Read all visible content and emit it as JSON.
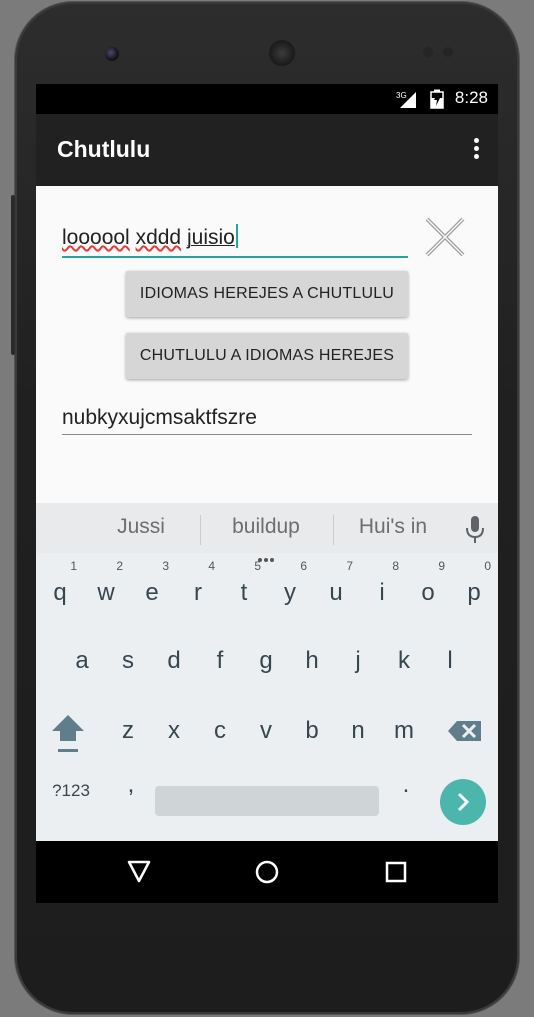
{
  "status_bar": {
    "network": "3G",
    "time": "8:28"
  },
  "app_bar": {
    "title": "Chutlulu",
    "overflow_icon": "more-vert-icon"
  },
  "main": {
    "input": {
      "words": [
        "loooool",
        "xddd",
        "juisio"
      ]
    },
    "clear_icon": "close-icon",
    "buttons": {
      "heretic_to_chutlulu": "IDIOMAS HEREJES A CHUTLULU",
      "chutlulu_to_heretic": "CHUTLULU A IDIOMAS HEREJES"
    },
    "output_value": "nubkyxujcmsaktfszre"
  },
  "keyboard": {
    "suggestions": [
      "Jussi",
      "buildup",
      "Hui's in"
    ],
    "row1": [
      {
        "key": "q",
        "hint": "1"
      },
      {
        "key": "w",
        "hint": "2"
      },
      {
        "key": "e",
        "hint": "3"
      },
      {
        "key": "r",
        "hint": "4"
      },
      {
        "key": "t",
        "hint": "5"
      },
      {
        "key": "y",
        "hint": "6"
      },
      {
        "key": "u",
        "hint": "7"
      },
      {
        "key": "i",
        "hint": "8"
      },
      {
        "key": "o",
        "hint": "9"
      },
      {
        "key": "p",
        "hint": "0"
      }
    ],
    "row2": [
      "a",
      "s",
      "d",
      "f",
      "g",
      "h",
      "j",
      "k",
      "l"
    ],
    "row3": [
      "z",
      "x",
      "c",
      "v",
      "b",
      "n",
      "m"
    ],
    "symbols_label": "?123",
    "comma": ",",
    "period": ".",
    "accent_color": "#4db6ac"
  },
  "colors": {
    "app_bar": "#212121",
    "input_underline": "#26a69a",
    "spell_error": "#e53935",
    "button_bg": "#d6d6d6"
  }
}
